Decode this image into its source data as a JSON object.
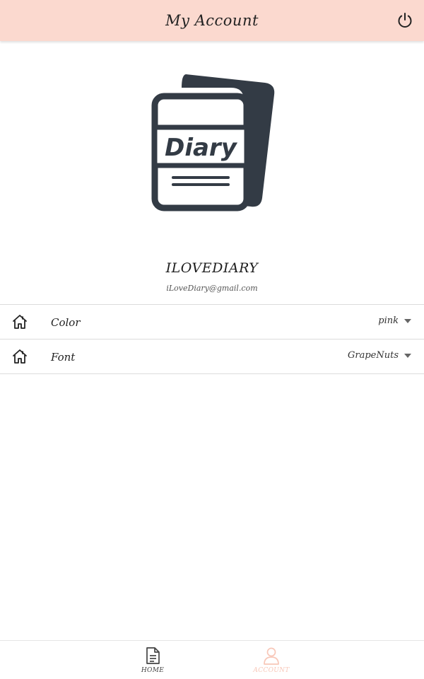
{
  "header": {
    "title": "My Account",
    "power_icon": "power-icon",
    "background_color": "#fbd9cf"
  },
  "logo": {
    "icon": "diary-logo-icon",
    "text": "Diary",
    "color": "#333b45"
  },
  "profile": {
    "username": "ILOVEDIARY",
    "email": "iLoveDiary@gmail.com"
  },
  "settings": [
    {
      "icon": "home-icon",
      "label": "Color",
      "value": "pink"
    },
    {
      "icon": "home-icon",
      "label": "Font",
      "value": "GrapeNuts"
    }
  ],
  "bottom_nav": {
    "items": [
      {
        "icon": "document-icon",
        "label": "HOME",
        "active": false
      },
      {
        "icon": "user-icon",
        "label": "ACCOUNT",
        "active": true
      }
    ],
    "active_color": "#f8c7b8"
  }
}
